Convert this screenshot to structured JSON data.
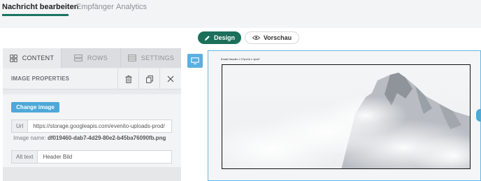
{
  "nav": {
    "tabs": [
      {
        "label": "Nachricht bearbeiten",
        "active": true
      },
      {
        "label": "Empfänger",
        "active": false
      },
      {
        "label": "Analytics",
        "active": false
      }
    ]
  },
  "toolbar": {
    "design_label": "Design",
    "preview_label": "Vorschau"
  },
  "editor": {
    "tabs": [
      {
        "label": "CONTENT",
        "icon": "grid-icon",
        "active": true
      },
      {
        "label": "ROWS",
        "icon": "rows-icon",
        "active": false
      },
      {
        "label": "SETTINGS",
        "icon": "settings-icon",
        "active": false
      }
    ],
    "properties_title": "IMAGE PROPERTIES",
    "tools": [
      "trash-icon",
      "copy-icon",
      "close-icon"
    ],
    "change_image_label": "Change image",
    "url_label": "Url",
    "url_value": "https://storage.googleapis.com/evenito-uploads-prod/",
    "image_name_label": "Image name:",
    "image_name_value": "df019460-dab7-4d29-80e2-b45ba76090fb.png",
    "alt_label": "Alt text",
    "alt_value": "Header Bild"
  },
  "canvas": {
    "header_text": "Email Header // 27px16 x 1pxH",
    "device_icon": "monitor-icon"
  },
  "colors": {
    "accent_green": "#1b6f5b",
    "accent_blue": "#4ea8d8",
    "canvas_border": "#67b7e6"
  }
}
